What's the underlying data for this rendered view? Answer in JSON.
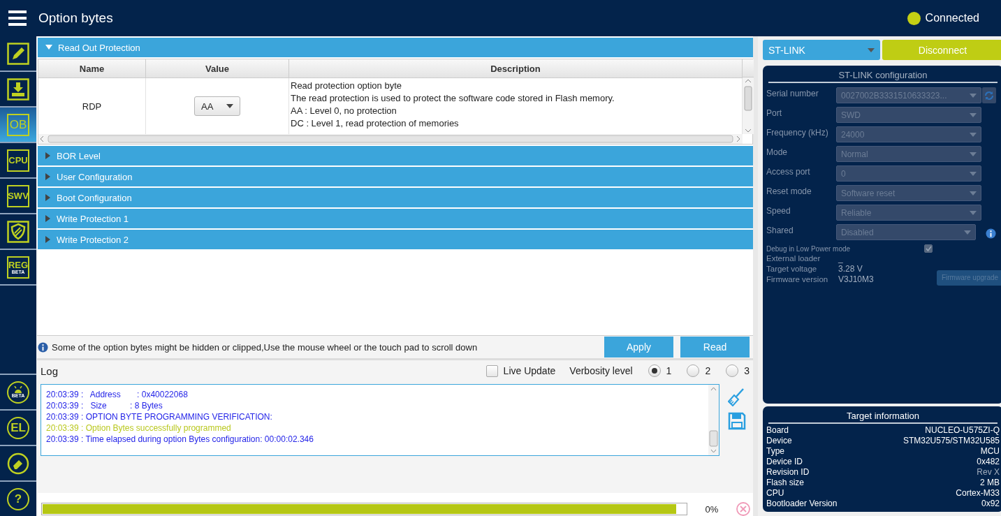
{
  "header": {
    "title": "Option bytes",
    "status": {
      "label": "Connected",
      "color": "#c4cf14"
    }
  },
  "sidebar": {
    "items": [
      {
        "kind": "edit",
        "selected": false
      },
      {
        "kind": "download",
        "selected": false
      },
      {
        "kind": "text",
        "label": "OB",
        "selected": true
      },
      {
        "kind": "text",
        "label": "CPU",
        "selected": false
      },
      {
        "kind": "text",
        "label": "SWV",
        "selected": false
      },
      {
        "kind": "shield",
        "selected": false
      },
      {
        "kind": "text",
        "label": "REG",
        "badge": "BETA",
        "selected": false
      }
    ],
    "bottom_items": [
      {
        "kind": "bug",
        "badge": "BETA",
        "selected": false
      },
      {
        "kind": "circle",
        "label": "EL",
        "selected": false
      },
      {
        "kind": "eraser",
        "selected": false
      },
      {
        "kind": "circle",
        "label": "?",
        "selected": false
      }
    ]
  },
  "sections": [
    {
      "title": "Read Out Protection",
      "expanded": true,
      "table": {
        "columns": [
          "Name",
          "Value",
          "Description"
        ],
        "rows": [
          {
            "name": "RDP",
            "value": "AA",
            "description": [
              "Read protection option byte",
              "The read protection is used to protect the software code stored in Flash memory.",
              "AA : Level 0, no protection",
              "DC : Level 1, read protection of memories"
            ]
          }
        ]
      }
    },
    {
      "title": "BOR Level",
      "expanded": false
    },
    {
      "title": "User Configuration",
      "expanded": false
    },
    {
      "title": "Boot Configuration",
      "expanded": false
    },
    {
      "title": "Write Protection 1",
      "expanded": false
    },
    {
      "title": "Write Protection 2",
      "expanded": false
    }
  ],
  "info_message": "Some of the option bytes might be hidden or clipped,Use the mouse wheel or the touch pad to scroll down",
  "buttons": [
    "Apply",
    "Read"
  ],
  "log": {
    "title": "Log",
    "live_update": {
      "label": "Live Update",
      "checked": false
    },
    "verbosity_label": "Verbosity level",
    "verbosity": [
      {
        "label": "1",
        "selected": true
      },
      {
        "label": "2",
        "selected": false
      },
      {
        "label": "3",
        "selected": false
      }
    ],
    "lines": [
      {
        "kind": "info",
        "text": "20:03:39 :   Address       : 0x40022068"
      },
      {
        "kind": "info",
        "text": "20:03:39 :   Size          : 8 Bytes"
      },
      {
        "kind": "info",
        "text": "20:03:39 : OPTION BYTE PROGRAMMING VERIFICATION:"
      },
      {
        "kind": "success",
        "text": "20:03:39 : Option Bytes successfully programmed"
      },
      {
        "kind": "info",
        "text": "20:03:39 : Time elapsed during option Bytes configuration: 00:00:02.346"
      }
    ]
  },
  "progress": {
    "level": 0.985,
    "reading": "0%"
  },
  "connection": {
    "interface": "ST-LINK",
    "button": "Disconnect",
    "config": {
      "title": "ST-LINK configuration",
      "fields": [
        {
          "kind": "select-refresh",
          "label": "Serial number",
          "value": "0027002B3331510633323..."
        },
        {
          "kind": "select",
          "label": "Port",
          "value": "SWD"
        },
        {
          "kind": "select",
          "label": "Frequency (kHz)",
          "value": "24000"
        },
        {
          "kind": "select",
          "label": "Mode",
          "value": "Normal"
        },
        {
          "kind": "select",
          "label": "Access port",
          "value": "0"
        },
        {
          "kind": "select",
          "label": "Reset mode",
          "value": "Software reset"
        },
        {
          "kind": "select",
          "label": "Speed",
          "value": "Reliable"
        },
        {
          "kind": "select-info",
          "label": "Shared",
          "value": "Disabled"
        }
      ],
      "debug_low_power": {
        "label": "Debug in Low Power mode",
        "checked": true
      },
      "info": [
        {
          "label": "External loader",
          "value": "_"
        },
        {
          "label": "Target voltage",
          "value": "3.28 V"
        },
        {
          "label": "Firmware version",
          "value": "V3J10M3"
        }
      ],
      "firmware_button": {
        "label": "Firmware upgrade",
        "disabled": true
      }
    }
  },
  "target": {
    "title": "Target information",
    "rows": [
      {
        "label": "Board",
        "value": "NUCLEO-U575ZI-Q",
        "disabled": false
      },
      {
        "label": "Device",
        "value": "STM32U575/STM32U585",
        "disabled": false
      },
      {
        "label": "Type",
        "value": "MCU",
        "disabled": false
      },
      {
        "label": "Device ID",
        "value": "0x482",
        "disabled": false
      },
      {
        "label": "Revision ID",
        "value": "Rev X",
        "disabled": true
      },
      {
        "label": "Flash size",
        "value": "2 MB",
        "disabled": false
      },
      {
        "label": "CPU",
        "value": "Cortex-M33",
        "disabled": false
      },
      {
        "label": "Bootloader Version",
        "value": "0x92",
        "disabled": false
      }
    ]
  }
}
